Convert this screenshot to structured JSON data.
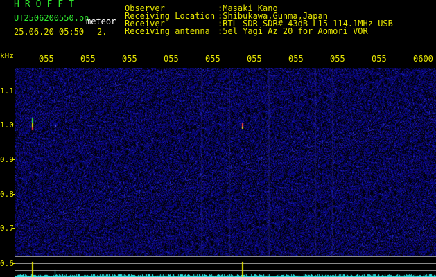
{
  "header": {
    "program": "HROFFT",
    "filename": "UT2506200550.pn",
    "mode": "meteor",
    "timestamp": "25.06.20 05:50",
    "interval": "2."
  },
  "station": {
    "labels": [
      "Observer",
      "Receiving Location",
      "Receiver",
      "Receiving antenna"
    ],
    "values": [
      ":Masaki Kano",
      ":Shibukawa,Gunma,Japan",
      ":RTL-SDR SDR# 43dB L15 114.1MHz USB",
      ":5el Yagi Az 20 for Aomori VOR"
    ]
  },
  "axis": {
    "y_unit": "kHz",
    "y_ticks": [
      "1.1",
      "1.0",
      "0.9",
      "0.8",
      "0.7",
      "0.6"
    ],
    "x_ticks": [
      "055",
      "055",
      "055",
      "055",
      "055",
      "055",
      "055",
      "055",
      "055",
      "0600"
    ]
  },
  "colors": {
    "header_green": "#2ee82e",
    "label_yellow": "#e6e600",
    "background": "#000000",
    "noise_blue": "#1a1a8c",
    "trace_cyan": "#2fe6e6"
  }
}
